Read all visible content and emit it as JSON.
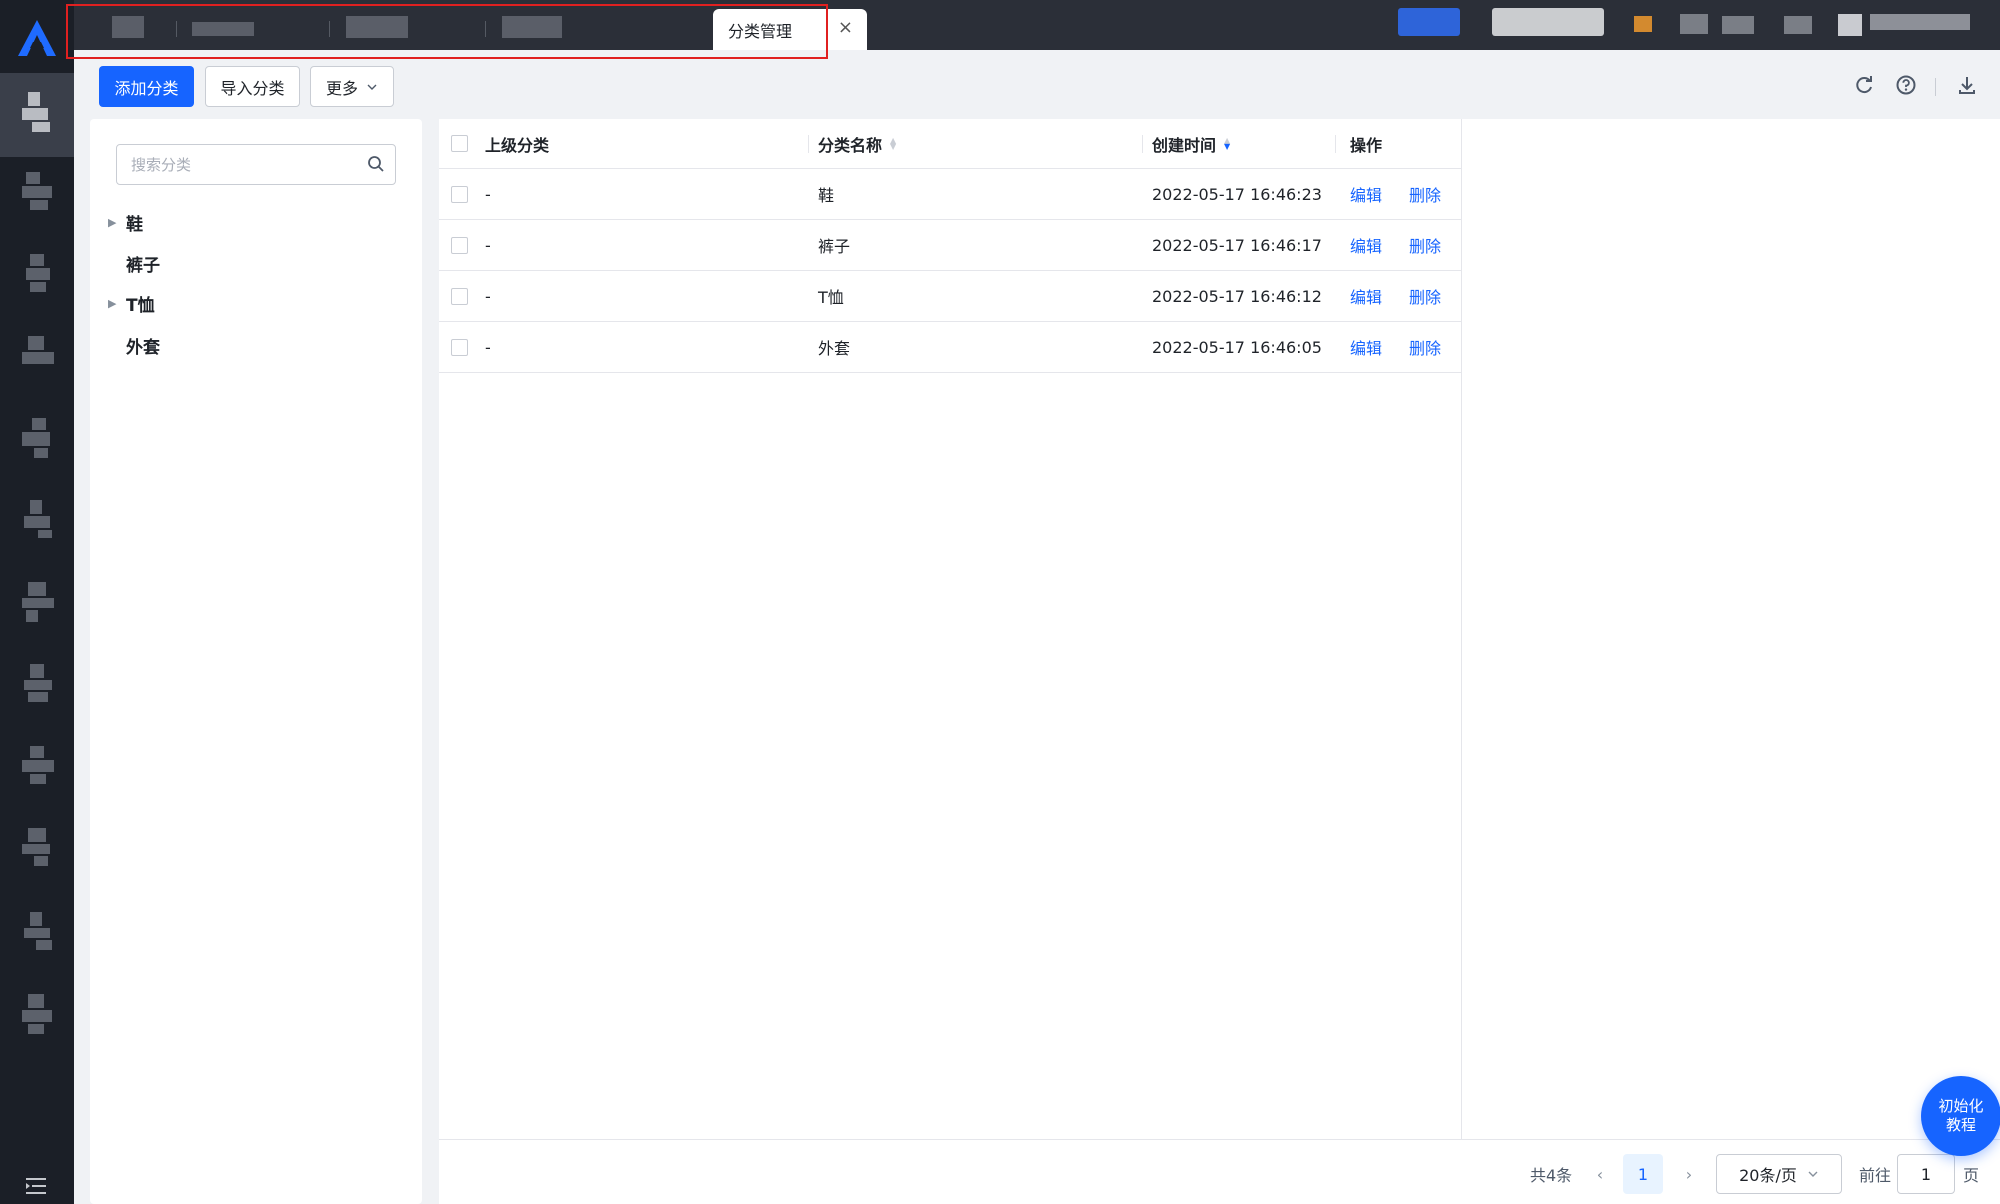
{
  "tabs": {
    "active_label": "分类管理",
    "close_symbol": "×"
  },
  "toolbar": {
    "add_label": "添加分类",
    "import_label": "导入分类",
    "more_label": "更多"
  },
  "tree": {
    "search_placeholder": "搜索分类",
    "items": [
      {
        "label": "鞋",
        "expandable": true
      },
      {
        "label": "裤子",
        "expandable": false
      },
      {
        "label": "T恤",
        "expandable": true
      },
      {
        "label": "外套",
        "expandable": false
      }
    ]
  },
  "table": {
    "headers": {
      "parent": "上级分类",
      "name": "分类名称",
      "created": "创建时间",
      "actions": "操作"
    },
    "rows": [
      {
        "parent": "-",
        "name": "鞋",
        "created": "2022-05-17 16:46:23",
        "edit": "编辑",
        "delete": "删除"
      },
      {
        "parent": "-",
        "name": "裤子",
        "created": "2022-05-17 16:46:17",
        "edit": "编辑",
        "delete": "删除"
      },
      {
        "parent": "-",
        "name": "T恤",
        "created": "2022-05-17 16:46:12",
        "edit": "编辑",
        "delete": "删除"
      },
      {
        "parent": "-",
        "name": "外套",
        "created": "2022-05-17 16:46:05",
        "edit": "编辑",
        "delete": "删除"
      }
    ]
  },
  "pagination": {
    "total_text": "共4条",
    "current_page": "1",
    "page_size": "20条/页",
    "goto_prefix": "前往",
    "goto_value": "1",
    "goto_suffix": "页"
  },
  "tutorial": {
    "line1": "初始化",
    "line2": "教程"
  },
  "colors": {
    "accent": "#1664ff",
    "sidebar_bg": "#1b1f27",
    "topbar_bg": "#2b2f38",
    "highlight_border": "#e02020"
  },
  "icons": {
    "logo": "app-logo-icon",
    "refresh": "refresh-icon",
    "help": "help-icon",
    "download": "download-icon",
    "search": "search-icon",
    "menu": "menu-collapse-icon"
  }
}
